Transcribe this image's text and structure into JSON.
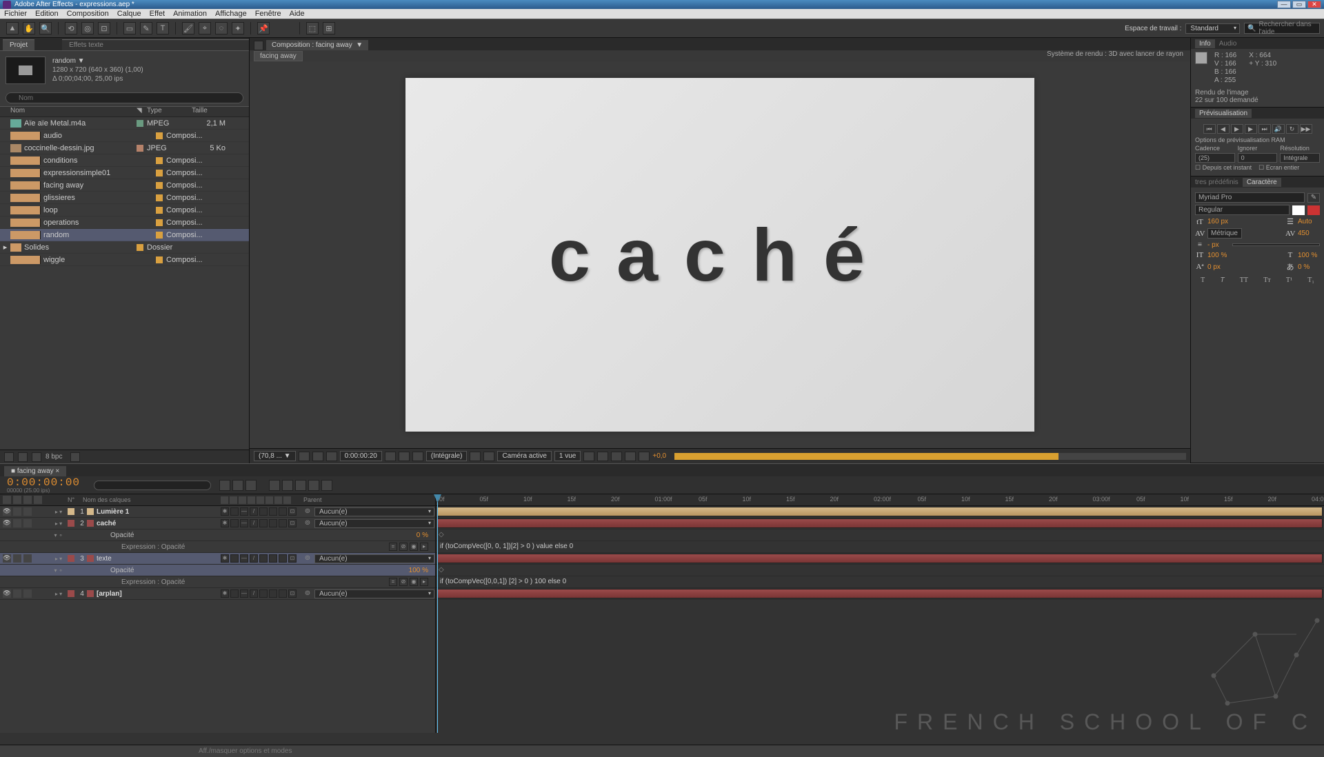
{
  "app_title": "Adobe After Effects - expressions.aep *",
  "menu": [
    "Fichier",
    "Edition",
    "Composition",
    "Calque",
    "Effet",
    "Animation",
    "Affichage",
    "Fenêtre",
    "Aide"
  ],
  "workspace_label": "Espace de travail :",
  "workspace_value": "Standard",
  "search_placeholder": "Rechercher dans l'aide",
  "project_tab": "Projet",
  "effects_tab": "Effets texte",
  "project_item": {
    "name": "random ▼",
    "line1": "1280 x 720  (640 x 360) (1,00)",
    "line2": "Δ 0;00;04;00, 25,00 ips"
  },
  "project_cols": {
    "name": "Nom",
    "type": "Type",
    "size": "Taille"
  },
  "project_rows": [
    {
      "name": "Aïe aïe Metal.m4a",
      "type": "MPEG",
      "size": "2,1 M",
      "tag": "#6a9a80",
      "icon": "m4a"
    },
    {
      "name": "audio",
      "type": "Composi...",
      "size": "",
      "tag": "#d9a040",
      "icon": "comp"
    },
    {
      "name": "coccinelle-dessin.jpg",
      "type": "JPEG",
      "size": "5 Ko",
      "tag": "#b6826a",
      "icon": "jpg"
    },
    {
      "name": "conditions",
      "type": "Composi...",
      "size": "",
      "tag": "#d9a040",
      "icon": "comp"
    },
    {
      "name": "expressionsimple01",
      "type": "Composi...",
      "size": "",
      "tag": "#d9a040",
      "icon": "comp"
    },
    {
      "name": "facing away",
      "type": "Composi...",
      "size": "",
      "tag": "#d9a040",
      "icon": "comp"
    },
    {
      "name": "glissieres",
      "type": "Composi...",
      "size": "",
      "tag": "#d9a040",
      "icon": "comp"
    },
    {
      "name": "loop",
      "type": "Composi...",
      "size": "",
      "tag": "#d9a040",
      "icon": "comp"
    },
    {
      "name": "operations",
      "type": "Composi...",
      "size": "",
      "tag": "#d9a040",
      "icon": "comp"
    },
    {
      "name": "random",
      "type": "Composi...",
      "size": "",
      "tag": "#d9a040",
      "icon": "comp",
      "selected": true
    },
    {
      "name": "Solides",
      "type": "Dossier",
      "size": "",
      "tag": "#d9a040",
      "icon": "folder"
    },
    {
      "name": "wiggle",
      "type": "Composi...",
      "size": "",
      "tag": "#d9a040",
      "icon": "comp"
    }
  ],
  "project_bpc": "8 bpc",
  "comp_tab_label": "Composition : facing away",
  "comp_sub_tab": "facing away",
  "render_system_label": "Système de rendu :",
  "render_system_value": "3D avec lancer de rayon",
  "canvas_text": "caché",
  "viewer_footer": {
    "zoom": "(70,8 ... ▼",
    "timecode": "0:00:00:20",
    "res": "(Intégrale)",
    "camera": "Caméra active",
    "views": "1 vue",
    "exposure": "+0,0"
  },
  "info": {
    "tab1": "Info",
    "tab2": "Audio",
    "R": "R : 166",
    "G": "V : 166",
    "B": "B : 166",
    "A": "A : 255",
    "X": "X : 664",
    "Y": "+  Y : 310",
    "render_status_1": "Rendu de l'image",
    "render_status_2": "22 sur 100 demandé"
  },
  "preview": {
    "tab": "Prévisualisation",
    "ram_label": "Options de prévisualisation RAM",
    "col1": "Cadence",
    "col2": "Ignorer",
    "col3": "Résolution",
    "v1": "(25)",
    "v2": "0",
    "v3": "Intégrale",
    "chk1": "Depuis cet instant",
    "chk2": "Ecran entier"
  },
  "char": {
    "tab1": "tres prédéfinis",
    "tab2": "Caractère",
    "font": "Myriad Pro",
    "style": "Regular",
    "size": "160",
    "size_unit": "px",
    "leading": "Auto",
    "kerning": "Métrique",
    "tracking": "450",
    "stroke": "-",
    "stroke_unit": "px",
    "vscale": "100",
    "vscale_unit": "%",
    "hscale": "100",
    "hscale_unit": "%",
    "baseline": "0",
    "baseline_unit": "px",
    "tsume": "0",
    "tsume_unit": "%"
  },
  "timeline": {
    "tab": "facing away",
    "timecode": "0:00:00:00",
    "timecode_sub": "00000 (25.00 ips)",
    "cols": {
      "layers": "Nom des calques",
      "parent": "Parent"
    },
    "parent_value": "Aucun(e)",
    "marks": [
      "00f",
      "05f",
      "10f",
      "15f",
      "20f",
      "01:00f",
      "05f",
      "10f",
      "15f",
      "20f",
      "02:00f",
      "05f",
      "10f",
      "15f",
      "20f",
      "03:00f",
      "05f",
      "10f",
      "15f",
      "20f",
      "04:0"
    ],
    "layers": [
      {
        "num": "1",
        "name": "Lumière 1",
        "label": "#d4b88a",
        "icon_color": "#fff",
        "bold": true
      },
      {
        "num": "2",
        "name": "caché",
        "label": "#9a4a4a",
        "bold": true
      },
      {
        "prop": true,
        "name": "Opacité",
        "val": "0 %"
      },
      {
        "expr": true,
        "name": "Expression : Opacité",
        "code": "if (toCompVec([0, 0, 1])[2] > 0 ) value else 0"
      },
      {
        "num": "3",
        "name": "texte",
        "label": "#9a4a4a",
        "selected": true
      },
      {
        "prop": true,
        "name": "Opacité",
        "val": "100 %",
        "selected": true
      },
      {
        "expr": true,
        "name": "Expression : Opacité",
        "code": "if (toCompVec([0,0,1]) [2] > 0 ) 100 else 0"
      },
      {
        "num": "4",
        "name": "[arplan]",
        "label": "#9a4a4a",
        "bold": true
      }
    ]
  },
  "status_hint": "Aff./masquer options et modes",
  "watermark": "FRENCH SCHOOL OF C"
}
